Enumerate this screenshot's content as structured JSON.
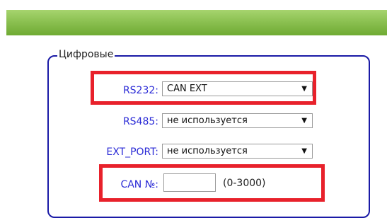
{
  "fieldset": {
    "legend": "Цифровые"
  },
  "rows": [
    {
      "label": "RS232:",
      "value": "CAN EXT"
    },
    {
      "label": "RS485:",
      "value": "не используется"
    },
    {
      "label": "EXT_PORT:",
      "value": "не используется"
    }
  ],
  "can": {
    "label": "CAN №:",
    "value": "",
    "range": "(0-3000)"
  },
  "icons": {
    "dropdown": "triangle-down-icon"
  },
  "colors": {
    "highlight": "#e8212b",
    "label": "#2b2bd6",
    "border": "#1a1aa6",
    "header": "#8cc152"
  }
}
